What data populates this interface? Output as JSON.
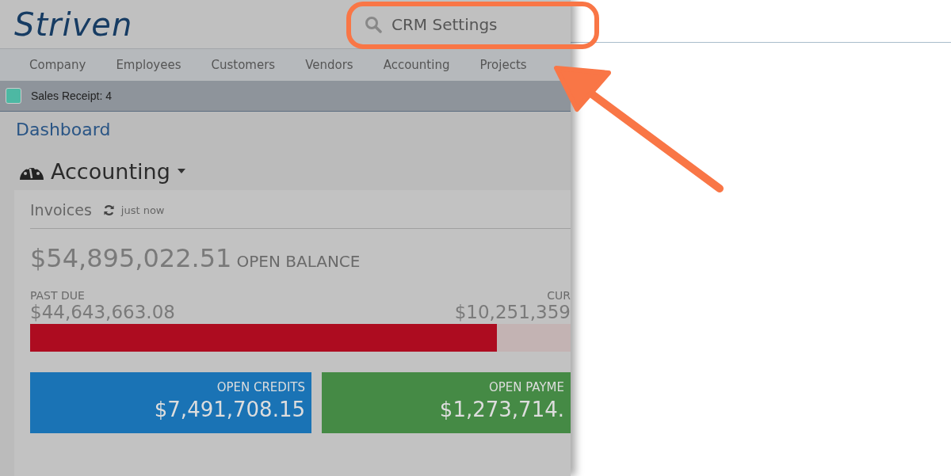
{
  "logo": "Striven",
  "search": {
    "value": "CRM Settings"
  },
  "nav": [
    {
      "label": "Company"
    },
    {
      "label": "Employees"
    },
    {
      "label": "Customers"
    },
    {
      "label": "Vendors"
    },
    {
      "label": "Accounting"
    },
    {
      "label": "Projects"
    }
  ],
  "notice": {
    "label": "Sales Receipt: 4",
    "color": "#4db8a3"
  },
  "breadcrumb": "Dashboard",
  "section": {
    "title": "Accounting"
  },
  "card": {
    "title": "Invoices",
    "updated": "just now",
    "balance": "$54,895,022.51",
    "balance_label": "OPEN BALANCE",
    "past_due": {
      "label": "PAST DUE",
      "amount": "$44,643,663.08"
    },
    "current": {
      "label": "CUR",
      "amount": "$10,251,359"
    },
    "bar": {
      "level": 0.864
    },
    "tiles": [
      {
        "label": "OPEN CREDITS",
        "amount": "$7,491,708.15",
        "color": "#1a73b5"
      },
      {
        "label": "OPEN PAYME",
        "amount": "$1,273,714.",
        "color": "#458a45"
      }
    ]
  }
}
